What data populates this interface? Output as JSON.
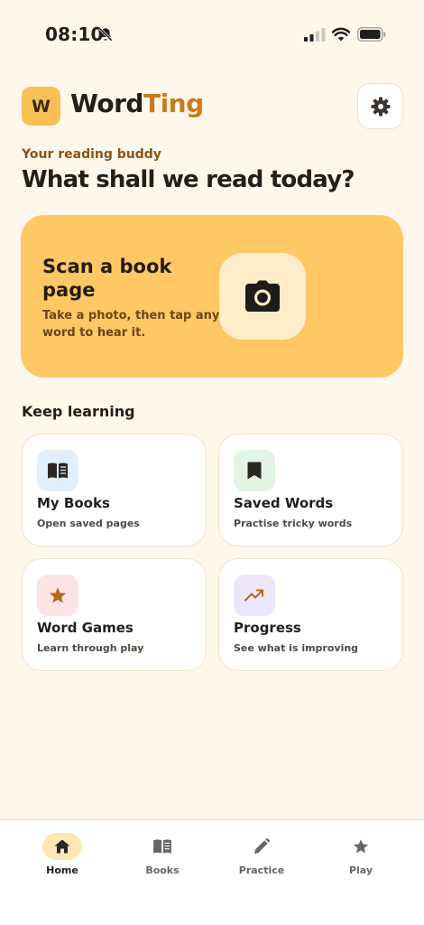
{
  "status_bar": {
    "time": "08:10"
  },
  "header": {
    "logo_letter": "W",
    "brand_part1": "Word",
    "brand_part2": "Ting"
  },
  "tagline": "Your reading buddy",
  "headline": "What shall we read today?",
  "scan_card": {
    "title": "Scan a book page",
    "description": "Take a photo, then tap any word to hear it."
  },
  "section_title": "Keep learning",
  "tiles": [
    {
      "title": "My Books",
      "subtitle": "Open saved pages",
      "icon": "book-icon",
      "icon_bg": "#E1EEFB"
    },
    {
      "title": "Saved Words",
      "subtitle": "Practise tricky words",
      "icon": "bookmark-icon",
      "icon_bg": "#E3F4E3"
    },
    {
      "title": "Word Games",
      "subtitle": "Learn through play",
      "icon": "star-icon",
      "icon_bg": "#FCE3E6"
    },
    {
      "title": "Progress",
      "subtitle": "See what is improving",
      "icon": "trending-up-icon",
      "icon_bg": "#EDE5FA"
    }
  ],
  "tab_bar": {
    "tabs": [
      {
        "label": "Home",
        "icon": "home-icon",
        "active": true
      },
      {
        "label": "Books",
        "icon": "book-icon",
        "active": false
      },
      {
        "label": "Practice",
        "icon": "pencil-icon",
        "active": false
      },
      {
        "label": "Play",
        "icon": "star-icon",
        "active": false
      }
    ]
  },
  "colors": {
    "background": "#FEF7EC",
    "accent": "#FEC865",
    "brand_orange": "#C97A1C"
  }
}
